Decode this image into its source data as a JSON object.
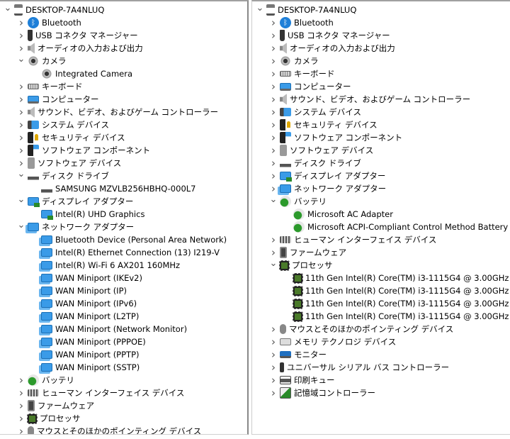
{
  "left_panel": {
    "items": [
      {
        "level": 0,
        "state": "open",
        "icon": "computer-icon",
        "label": "DESKTOP-7A4NLUQ"
      },
      {
        "level": 1,
        "state": "closed",
        "icon": "bluetooth-icon",
        "label": "Bluetooth"
      },
      {
        "level": 1,
        "state": "closed",
        "icon": "usb-icon",
        "label": "USB コネクタ マネージャー"
      },
      {
        "level": 1,
        "state": "closed",
        "icon": "audio-icon",
        "label": "オーディオの入力および出力"
      },
      {
        "level": 1,
        "state": "open",
        "icon": "camera-icon",
        "label": "カメラ"
      },
      {
        "level": 2,
        "state": "leaf",
        "icon": "camera-icon",
        "label": "Integrated Camera"
      },
      {
        "level": 1,
        "state": "closed",
        "icon": "keyboard-icon",
        "label": "キーボード"
      },
      {
        "level": 1,
        "state": "closed",
        "icon": "monitor-icon",
        "label": "コンピューター"
      },
      {
        "level": 1,
        "state": "closed",
        "icon": "audio-icon",
        "label": "サウンド、ビデオ、およびゲーム コントローラー"
      },
      {
        "level": 1,
        "state": "closed",
        "icon": "system-devices-icon",
        "label": "システム デバイス"
      },
      {
        "level": 1,
        "state": "closed",
        "icon": "security-key-icon",
        "label": "セキュリティ デバイス"
      },
      {
        "level": 1,
        "state": "closed",
        "icon": "software-component-icon",
        "label": "ソフトウェア コンポーネント"
      },
      {
        "level": 1,
        "state": "closed",
        "icon": "software-device-icon",
        "label": "ソフトウェア デバイス"
      },
      {
        "level": 1,
        "state": "open",
        "icon": "disk-drive-icon",
        "label": "ディスク ドライブ"
      },
      {
        "level": 2,
        "state": "leaf",
        "icon": "disk-drive-icon",
        "label": "SAMSUNG MZVLB256HBHQ-000L7"
      },
      {
        "level": 1,
        "state": "open",
        "icon": "display-adapter-icon",
        "label": "ディスプレイ アダプター"
      },
      {
        "level": 2,
        "state": "leaf",
        "icon": "display-adapter-icon",
        "label": "Intel(R) UHD Graphics"
      },
      {
        "level": 1,
        "state": "open",
        "icon": "network-adapter-icon",
        "label": "ネットワーク アダプター"
      },
      {
        "level": 2,
        "state": "leaf",
        "icon": "network-adapter-icon",
        "label": "Bluetooth Device (Personal Area Network)"
      },
      {
        "level": 2,
        "state": "leaf",
        "icon": "network-adapter-icon",
        "label": "Intel(R) Ethernet Connection (13) I219-V"
      },
      {
        "level": 2,
        "state": "leaf",
        "icon": "network-adapter-icon",
        "label": "Intel(R) Wi-Fi 6 AX201 160MHz"
      },
      {
        "level": 2,
        "state": "leaf",
        "icon": "network-adapter-icon",
        "label": "WAN Miniport (IKEv2)"
      },
      {
        "level": 2,
        "state": "leaf",
        "icon": "network-adapter-icon",
        "label": "WAN Miniport (IP)"
      },
      {
        "level": 2,
        "state": "leaf",
        "icon": "network-adapter-icon",
        "label": "WAN Miniport (IPv6)"
      },
      {
        "level": 2,
        "state": "leaf",
        "icon": "network-adapter-icon",
        "label": "WAN Miniport (L2TP)"
      },
      {
        "level": 2,
        "state": "leaf",
        "icon": "network-adapter-icon",
        "label": "WAN Miniport (Network Monitor)"
      },
      {
        "level": 2,
        "state": "leaf",
        "icon": "network-adapter-icon",
        "label": "WAN Miniport (PPPOE)"
      },
      {
        "level": 2,
        "state": "leaf",
        "icon": "network-adapter-icon",
        "label": "WAN Miniport (PPTP)"
      },
      {
        "level": 2,
        "state": "leaf",
        "icon": "network-adapter-icon",
        "label": "WAN Miniport (SSTP)"
      },
      {
        "level": 1,
        "state": "closed",
        "icon": "battery-icon",
        "label": "バッテリ"
      },
      {
        "level": 1,
        "state": "closed",
        "icon": "hid-icon",
        "label": "ヒューマン インターフェイス デバイス"
      },
      {
        "level": 1,
        "state": "closed",
        "icon": "firmware-icon",
        "label": "ファームウェア"
      },
      {
        "level": 1,
        "state": "closed",
        "icon": "processor-icon",
        "label": "プロセッサ"
      },
      {
        "level": 1,
        "state": "closed",
        "icon": "mouse-icon",
        "label": "マウスとそのほかのポインティング デバイス"
      }
    ]
  },
  "right_panel": {
    "items": [
      {
        "level": 0,
        "state": "open",
        "icon": "computer-icon",
        "label": "DESKTOP-7A4NLUQ"
      },
      {
        "level": 1,
        "state": "closed",
        "icon": "bluetooth-icon",
        "label": "Bluetooth"
      },
      {
        "level": 1,
        "state": "closed",
        "icon": "usb-icon",
        "label": "USB コネクタ マネージャー"
      },
      {
        "level": 1,
        "state": "closed",
        "icon": "audio-icon",
        "label": "オーディオの入力および出力"
      },
      {
        "level": 1,
        "state": "closed",
        "icon": "camera-icon",
        "label": "カメラ"
      },
      {
        "level": 1,
        "state": "closed",
        "icon": "keyboard-icon",
        "label": "キーボード"
      },
      {
        "level": 1,
        "state": "closed",
        "icon": "monitor-icon",
        "label": "コンピューター"
      },
      {
        "level": 1,
        "state": "closed",
        "icon": "audio-icon",
        "label": "サウンド、ビデオ、およびゲーム コントローラー"
      },
      {
        "level": 1,
        "state": "closed",
        "icon": "system-devices-icon",
        "label": "システム デバイス"
      },
      {
        "level": 1,
        "state": "closed",
        "icon": "security-key-icon",
        "label": "セキュリティ デバイス"
      },
      {
        "level": 1,
        "state": "closed",
        "icon": "software-component-icon",
        "label": "ソフトウェア コンポーネント"
      },
      {
        "level": 1,
        "state": "closed",
        "icon": "software-device-icon",
        "label": "ソフトウェア デバイス"
      },
      {
        "level": 1,
        "state": "closed",
        "icon": "disk-drive-icon",
        "label": "ディスク ドライブ"
      },
      {
        "level": 1,
        "state": "closed",
        "icon": "display-adapter-icon",
        "label": "ディスプレイ アダプター"
      },
      {
        "level": 1,
        "state": "closed",
        "icon": "network-adapter-icon",
        "label": "ネットワーク アダプター"
      },
      {
        "level": 1,
        "state": "open",
        "icon": "battery-icon",
        "label": "バッテリ"
      },
      {
        "level": 2,
        "state": "leaf",
        "icon": "battery-icon",
        "label": "Microsoft AC Adapter"
      },
      {
        "level": 2,
        "state": "leaf",
        "icon": "battery-icon",
        "label": "Microsoft ACPI-Compliant Control Method Battery"
      },
      {
        "level": 1,
        "state": "closed",
        "icon": "hid-icon",
        "label": "ヒューマン インターフェイス デバイス"
      },
      {
        "level": 1,
        "state": "closed",
        "icon": "firmware-icon",
        "label": "ファームウェア"
      },
      {
        "level": 1,
        "state": "open",
        "icon": "processor-icon",
        "label": "プロセッサ"
      },
      {
        "level": 2,
        "state": "leaf",
        "icon": "processor-icon",
        "label": "11th Gen Intel(R) Core(TM) i3-1115G4 @ 3.00GHz"
      },
      {
        "level": 2,
        "state": "leaf",
        "icon": "processor-icon",
        "label": "11th Gen Intel(R) Core(TM) i3-1115G4 @ 3.00GHz"
      },
      {
        "level": 2,
        "state": "leaf",
        "icon": "processor-icon",
        "label": "11th Gen Intel(R) Core(TM) i3-1115G4 @ 3.00GHz"
      },
      {
        "level": 2,
        "state": "leaf",
        "icon": "processor-icon",
        "label": "11th Gen Intel(R) Core(TM) i3-1115G4 @ 3.00GHz"
      },
      {
        "level": 1,
        "state": "closed",
        "icon": "mouse-icon",
        "label": "マウスとそのほかのポインティング デバイス"
      },
      {
        "level": 1,
        "state": "closed",
        "icon": "memory-icon",
        "label": "メモリ テクノロジ デバイス"
      },
      {
        "level": 1,
        "state": "closed",
        "icon": "monitor-icon-2",
        "label": "モニター"
      },
      {
        "level": 1,
        "state": "closed",
        "icon": "usb-serial-icon",
        "label": "ユニバーサル シリアル バス コントローラー"
      },
      {
        "level": 1,
        "state": "closed",
        "icon": "print-queue-icon",
        "label": "印刷キュー"
      },
      {
        "level": 1,
        "state": "closed",
        "icon": "storage-controller-icon",
        "label": "記憶域コントローラー"
      }
    ]
  }
}
